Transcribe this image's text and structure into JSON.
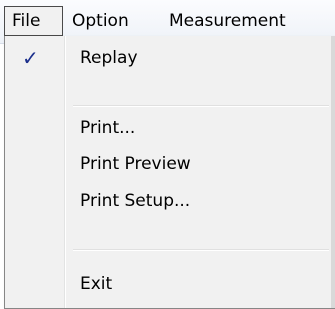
{
  "menubar": {
    "items": [
      {
        "label": "File"
      },
      {
        "label": "Option"
      },
      {
        "label": "Measurement"
      }
    ]
  },
  "file_menu": {
    "items": [
      {
        "label": "Replay",
        "checked": true,
        "check_glyph": "✓"
      },
      {
        "label": "Print..."
      },
      {
        "label": "Print Preview"
      },
      {
        "label": "Print Setup..."
      },
      {
        "label": "Exit"
      }
    ]
  },
  "colors": {
    "checkmark": "#1b2f8c",
    "menu_background": "#f1f1f1"
  }
}
